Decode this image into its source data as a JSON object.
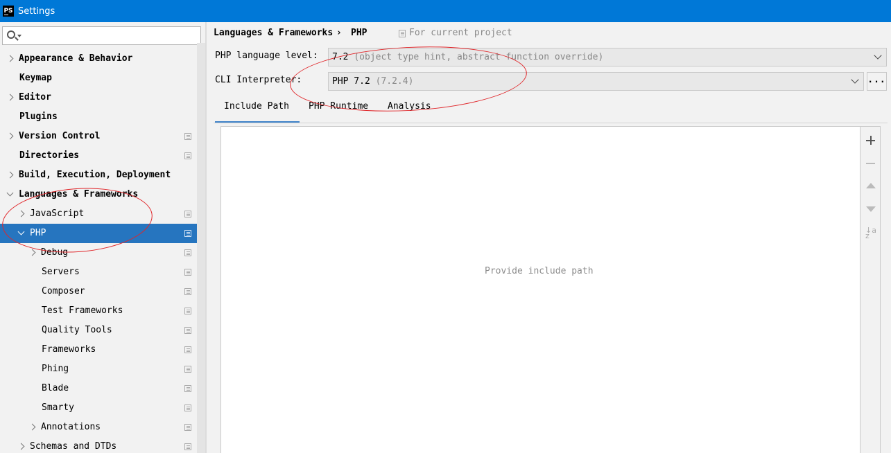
{
  "window": {
    "title": "Settings",
    "app_icon_text": "PS"
  },
  "search": {
    "value": "",
    "placeholder": ""
  },
  "sidebar": {
    "items": [
      {
        "label": "Appearance & Behavior",
        "level": 0,
        "expander": "collapsed",
        "bold": true,
        "project_icon": false,
        "selected": false
      },
      {
        "label": "Keymap",
        "level": 0,
        "expander": "none",
        "bold": true,
        "project_icon": false,
        "selected": false
      },
      {
        "label": "Editor",
        "level": 0,
        "expander": "collapsed",
        "bold": true,
        "project_icon": false,
        "selected": false
      },
      {
        "label": "Plugins",
        "level": 0,
        "expander": "none",
        "bold": true,
        "project_icon": false,
        "selected": false
      },
      {
        "label": "Version Control",
        "level": 0,
        "expander": "collapsed",
        "bold": true,
        "project_icon": true,
        "selected": false
      },
      {
        "label": "Directories",
        "level": 0,
        "expander": "none",
        "bold": true,
        "project_icon": true,
        "selected": false
      },
      {
        "label": "Build, Execution, Deployment",
        "level": 0,
        "expander": "collapsed",
        "bold": true,
        "project_icon": false,
        "selected": false
      },
      {
        "label": "Languages & Frameworks",
        "level": 0,
        "expander": "expanded",
        "bold": true,
        "project_icon": false,
        "selected": false
      },
      {
        "label": "JavaScript",
        "level": 1,
        "expander": "collapsed",
        "bold": false,
        "project_icon": true,
        "selected": false
      },
      {
        "label": "PHP",
        "level": 1,
        "expander": "expanded",
        "bold": false,
        "project_icon": true,
        "selected": true
      },
      {
        "label": "Debug",
        "level": 2,
        "expander": "collapsed",
        "bold": false,
        "project_icon": true,
        "selected": false
      },
      {
        "label": "Servers",
        "level": 2,
        "expander": "none",
        "bold": false,
        "project_icon": true,
        "selected": false
      },
      {
        "label": "Composer",
        "level": 2,
        "expander": "none",
        "bold": false,
        "project_icon": true,
        "selected": false
      },
      {
        "label": "Test Frameworks",
        "level": 2,
        "expander": "none",
        "bold": false,
        "project_icon": true,
        "selected": false
      },
      {
        "label": "Quality Tools",
        "level": 2,
        "expander": "none",
        "bold": false,
        "project_icon": true,
        "selected": false
      },
      {
        "label": "Frameworks",
        "level": 2,
        "expander": "none",
        "bold": false,
        "project_icon": true,
        "selected": false
      },
      {
        "label": "Phing",
        "level": 2,
        "expander": "none",
        "bold": false,
        "project_icon": true,
        "selected": false
      },
      {
        "label": "Blade",
        "level": 2,
        "expander": "none",
        "bold": false,
        "project_icon": true,
        "selected": false
      },
      {
        "label": "Smarty",
        "level": 2,
        "expander": "none",
        "bold": false,
        "project_icon": true,
        "selected": false
      },
      {
        "label": "Annotations",
        "level": 2,
        "expander": "collapsed",
        "bold": false,
        "project_icon": true,
        "selected": false
      },
      {
        "label": "Schemas and DTDs",
        "level": 1,
        "expander": "collapsed",
        "bold": false,
        "project_icon": true,
        "selected": false
      }
    ]
  },
  "content": {
    "breadcrumb": {
      "parent": "Languages & Frameworks",
      "separator": "›",
      "current": "PHP"
    },
    "scope_label": "For current project",
    "language_level": {
      "label": "PHP language level:",
      "value": "7.2",
      "hint": "(object type hint, abstract function override)"
    },
    "cli_interpreter": {
      "label": "CLI Interpreter:",
      "value": "PHP 7.2",
      "hint": "(7.2.4)",
      "browse_label": "..."
    },
    "tabs": [
      {
        "label": "Include Path",
        "active": true
      },
      {
        "label": "PHP Runtime",
        "active": false
      },
      {
        "label": "Analysis",
        "active": false
      }
    ],
    "include_path": {
      "empty_text": "Provide include path"
    },
    "toolbar": {
      "sort_label": "↓a z"
    }
  },
  "colors": {
    "title_bar": "#0078d7",
    "selection": "#2675bf",
    "active_tab_underline": "#4083c9",
    "annotation": "#e0262a"
  }
}
